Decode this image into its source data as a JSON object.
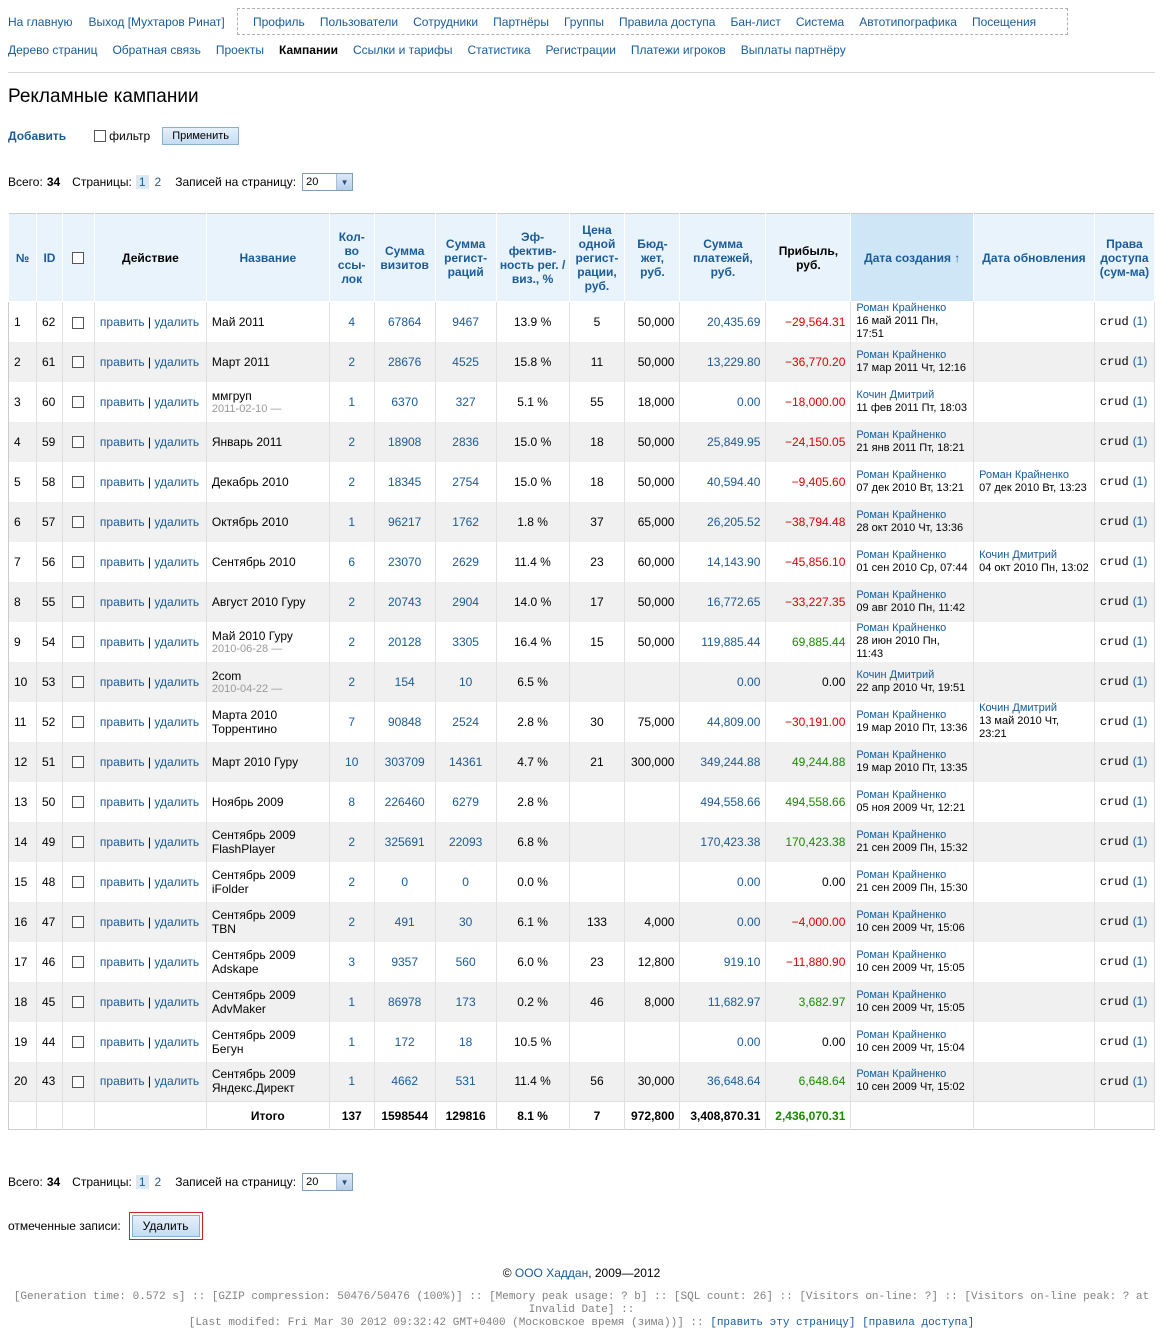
{
  "nav_top": {
    "left": [
      "На главную",
      "Выход [Мухтаров Ринат]"
    ],
    "box": [
      "Профиль",
      "Пользователи",
      "Сотрудники",
      "Партнёры",
      "Группы",
      "Правила доступа",
      "Бан-лист",
      "Система",
      "Автотипографика",
      "Посещения"
    ]
  },
  "nav_sub": {
    "items": [
      "Дерево страниц",
      "Обратная связь",
      "Проекты",
      "Кампании",
      "Ссылки и тарифы",
      "Статистика",
      "Регистрации",
      "Платежи игроков",
      "Выплаты партнёру"
    ],
    "active": "Кампании"
  },
  "page_title": "Рекламные кампании",
  "toolbar": {
    "add": "Добавить",
    "filter": "фильтр",
    "apply": "Применить"
  },
  "pager": {
    "total_label": "Всего:",
    "total": "34",
    "pages_label": "Страницы:",
    "page1": "1",
    "page2": "2",
    "per_page_label": "Записей на страницу:",
    "per_page": "20"
  },
  "table": {
    "headers": {
      "num": "№",
      "id": "ID",
      "action": "Действие",
      "name": "Название",
      "links": "Кол-во ссы-лок",
      "visits": "Сумма визитов",
      "regs": "Сумма регист-раций",
      "eff": "Эф-фектив-ность рег. / виз., %",
      "price": "Цена одной регист-рации, руб.",
      "budget": "Бюд-жет, руб.",
      "payments": "Сумма платежей, руб.",
      "profit": "Прибыль, руб.",
      "created": "Дата создания ↑",
      "updated": "Дата обновления",
      "rights": "Права доступа (сум-ма)"
    },
    "edit": "править",
    "delete": "удалить",
    "rows": [
      {
        "n": "1",
        "id": "62",
        "name": "Май 2011",
        "sub": "",
        "links": "4",
        "visits": "67864",
        "regs": "9467",
        "eff": "13.9 %",
        "price": "5",
        "budget": "50,000",
        "pay": "20,435.69",
        "profit": "−29,564.31",
        "ps": "neg",
        "cw": "Роман Крайненко",
        "cd": "16 май 2011 Пн, 17:51",
        "uw": "",
        "ud": "",
        "rights": "crud",
        "rc": "(1)"
      },
      {
        "n": "2",
        "id": "61",
        "name": "Март 2011",
        "sub": "",
        "links": "2",
        "visits": "28676",
        "regs": "4525",
        "eff": "15.8 %",
        "price": "11",
        "budget": "50,000",
        "pay": "13,229.80",
        "profit": "−36,770.20",
        "ps": "neg",
        "cw": "Роман Крайненко",
        "cd": "17 мар 2011 Чт, 12:16",
        "uw": "",
        "ud": "",
        "rights": "crud",
        "rc": "(1)"
      },
      {
        "n": "3",
        "id": "60",
        "name": "ммгруп",
        "sub": "2011-02-10 —",
        "links": "1",
        "visits": "6370",
        "regs": "327",
        "eff": "5.1 %",
        "price": "55",
        "budget": "18,000",
        "pay": "0.00",
        "profit": "−18,000.00",
        "ps": "neg",
        "cw": "Кочин Дмитрий",
        "cd": "11 фев 2011 Пт, 18:03",
        "uw": "",
        "ud": "",
        "rights": "crud",
        "rc": "(1)"
      },
      {
        "n": "4",
        "id": "59",
        "name": "Январь 2011",
        "sub": "",
        "links": "2",
        "visits": "18908",
        "regs": "2836",
        "eff": "15.0 %",
        "price": "18",
        "budget": "50,000",
        "pay": "25,849.95",
        "profit": "−24,150.05",
        "ps": "neg",
        "cw": "Роман Крайненко",
        "cd": "21 янв 2011 Пт, 18:21",
        "uw": "",
        "ud": "",
        "rights": "crud",
        "rc": "(1)"
      },
      {
        "n": "5",
        "id": "58",
        "name": "Декабрь 2010",
        "sub": "",
        "links": "2",
        "visits": "18345",
        "regs": "2754",
        "eff": "15.0 %",
        "price": "18",
        "budget": "50,000",
        "pay": "40,594.40",
        "profit": "−9,405.60",
        "ps": "neg",
        "cw": "Роман Крайненко",
        "cd": "07 дек 2010 Вт, 13:21",
        "uw": "Роман Крайненко",
        "ud": "07 дек 2010 Вт, 13:23",
        "rights": "crud",
        "rc": "(1)"
      },
      {
        "n": "6",
        "id": "57",
        "name": "Октябрь 2010",
        "sub": "",
        "links": "1",
        "visits": "96217",
        "regs": "1762",
        "eff": "1.8 %",
        "price": "37",
        "budget": "65,000",
        "pay": "26,205.52",
        "profit": "−38,794.48",
        "ps": "neg",
        "cw": "Роман Крайненко",
        "cd": "28 окт 2010 Чт, 13:36",
        "uw": "",
        "ud": "",
        "rights": "crud",
        "rc": "(1)"
      },
      {
        "n": "7",
        "id": "56",
        "name": "Сентябрь 2010",
        "sub": "",
        "links": "6",
        "visits": "23070",
        "regs": "2629",
        "eff": "11.4 %",
        "price": "23",
        "budget": "60,000",
        "pay": "14,143.90",
        "profit": "−45,856.10",
        "ps": "neg",
        "cw": "Роман Крайненко",
        "cd": "01 сен 2010 Ср, 07:44",
        "uw": "Кочин Дмитрий",
        "ud": "04 окт 2010 Пн, 13:02",
        "rights": "crud",
        "rc": "(1)"
      },
      {
        "n": "8",
        "id": "55",
        "name": "Август 2010 Гуру",
        "sub": "",
        "links": "2",
        "visits": "20743",
        "regs": "2904",
        "eff": "14.0 %",
        "price": "17",
        "budget": "50,000",
        "pay": "16,772.65",
        "profit": "−33,227.35",
        "ps": "neg",
        "cw": "Роман Крайненко",
        "cd": "09 авг 2010 Пн, 11:42",
        "uw": "",
        "ud": "",
        "rights": "crud",
        "rc": "(1)"
      },
      {
        "n": "9",
        "id": "54",
        "name": "Май 2010 Гуру",
        "sub": "2010-06-28 —",
        "links": "2",
        "visits": "20128",
        "regs": "3305",
        "eff": "16.4 %",
        "price": "15",
        "budget": "50,000",
        "pay": "119,885.44",
        "profit": "69,885.44",
        "ps": "pos",
        "cw": "Роман Крайненко",
        "cd": "28 июн 2010 Пн, 11:43",
        "uw": "",
        "ud": "",
        "rights": "crud",
        "rc": "(1)"
      },
      {
        "n": "10",
        "id": "53",
        "name": "2com",
        "sub": "2010-04-22 —",
        "links": "2",
        "visits": "154",
        "regs": "10",
        "eff": "6.5 %",
        "price": "",
        "budget": "",
        "pay": "0.00",
        "profit": "0.00",
        "ps": "zero",
        "cw": "Кочин Дмитрий",
        "cd": "22 апр 2010 Чт, 19:51",
        "uw": "",
        "ud": "",
        "rights": "crud",
        "rc": "(1)"
      },
      {
        "n": "11",
        "id": "52",
        "name": "Марта 2010\nТоррентино",
        "sub": "",
        "links": "7",
        "visits": "90848",
        "regs": "2524",
        "eff": "2.8 %",
        "price": "30",
        "budget": "75,000",
        "pay": "44,809.00",
        "profit": "−30,191.00",
        "ps": "neg",
        "cw": "Роман Крайненко",
        "cd": "19 мар 2010 Пт, 13:36",
        "uw": "Кочин Дмитрий",
        "ud": "13 май 2010 Чт, 23:21",
        "rights": "crud",
        "rc": "(1)"
      },
      {
        "n": "12",
        "id": "51",
        "name": "Март 2010 Гуру",
        "sub": "",
        "links": "10",
        "visits": "303709",
        "regs": "14361",
        "eff": "4.7 %",
        "price": "21",
        "budget": "300,000",
        "pay": "349,244.88",
        "profit": "49,244.88",
        "ps": "pos",
        "cw": "Роман Крайненко",
        "cd": "19 мар 2010 Пт, 13:35",
        "uw": "",
        "ud": "",
        "rights": "crud",
        "rc": "(1)"
      },
      {
        "n": "13",
        "id": "50",
        "name": "Ноябрь 2009",
        "sub": "",
        "links": "8",
        "visits": "226460",
        "regs": "6279",
        "eff": "2.8 %",
        "price": "",
        "budget": "",
        "pay": "494,558.66",
        "profit": "494,558.66",
        "ps": "pos",
        "cw": "Роман Крайненко",
        "cd": "05 ноя 2009 Чт, 12:21",
        "uw": "",
        "ud": "",
        "rights": "crud",
        "rc": "(1)"
      },
      {
        "n": "14",
        "id": "49",
        "name": "Сентябрь 2009\nFlashPlayer",
        "sub": "",
        "links": "2",
        "visits": "325691",
        "regs": "22093",
        "eff": "6.8 %",
        "price": "",
        "budget": "",
        "pay": "170,423.38",
        "profit": "170,423.38",
        "ps": "pos",
        "cw": "Роман Крайненко",
        "cd": "21 сен 2009 Пн, 15:32",
        "uw": "",
        "ud": "",
        "rights": "crud",
        "rc": "(1)"
      },
      {
        "n": "15",
        "id": "48",
        "name": "Сентябрь 2009\niFolder",
        "sub": "",
        "links": "2",
        "visits": "0",
        "regs": "0",
        "eff": "0.0 %",
        "price": "",
        "budget": "",
        "pay": "0.00",
        "profit": "0.00",
        "ps": "zero",
        "cw": "Роман Крайненко",
        "cd": "21 сен 2009 Пн, 15:30",
        "uw": "",
        "ud": "",
        "rights": "crud",
        "rc": "(1)"
      },
      {
        "n": "16",
        "id": "47",
        "name": "Сентябрь 2009\nTBN",
        "sub": "",
        "links": "2",
        "visits": "491",
        "regs": "30",
        "eff": "6.1 %",
        "price": "133",
        "budget": "4,000",
        "pay": "0.00",
        "profit": "−4,000.00",
        "ps": "neg",
        "cw": "Роман Крайненко",
        "cd": "10 сен 2009 Чт, 15:06",
        "uw": "",
        "ud": "",
        "rights": "crud",
        "rc": "(1)"
      },
      {
        "n": "17",
        "id": "46",
        "name": "Сентябрь 2009\nAdskape",
        "sub": "",
        "links": "3",
        "visits": "9357",
        "regs": "560",
        "eff": "6.0 %",
        "price": "23",
        "budget": "12,800",
        "pay": "919.10",
        "profit": "−11,880.90",
        "ps": "neg",
        "cw": "Роман Крайненко",
        "cd": "10 сен 2009 Чт, 15:05",
        "uw": "",
        "ud": "",
        "rights": "crud",
        "rc": "(1)"
      },
      {
        "n": "18",
        "id": "45",
        "name": "Сентябрь 2009\nAdvMaker",
        "sub": "",
        "links": "1",
        "visits": "86978",
        "regs": "173",
        "eff": "0.2 %",
        "price": "46",
        "budget": "8,000",
        "pay": "11,682.97",
        "profit": "3,682.97",
        "ps": "pos",
        "cw": "Роман Крайненко",
        "cd": "10 сен 2009 Чт, 15:05",
        "uw": "",
        "ud": "",
        "rights": "crud",
        "rc": "(1)"
      },
      {
        "n": "19",
        "id": "44",
        "name": "Сентябрь 2009\nБегун",
        "sub": "",
        "links": "1",
        "visits": "172",
        "regs": "18",
        "eff": "10.5 %",
        "price": "",
        "budget": "",
        "pay": "0.00",
        "profit": "0.00",
        "ps": "zero",
        "cw": "Роман Крайненко",
        "cd": "10 сен 2009 Чт, 15:04",
        "uw": "",
        "ud": "",
        "rights": "crud",
        "rc": "(1)"
      },
      {
        "n": "20",
        "id": "43",
        "name": "Сентябрь 2009\nЯндекс.Директ",
        "sub": "",
        "links": "1",
        "visits": "4662",
        "regs": "531",
        "eff": "11.4 %",
        "price": "56",
        "budget": "30,000",
        "pay": "36,648.64",
        "profit": "6,648.64",
        "ps": "pos",
        "cw": "Роман Крайненко",
        "cd": "10 сен 2009 Чт, 15:02",
        "uw": "",
        "ud": "",
        "rights": "crud",
        "rc": "(1)"
      }
    ],
    "totals": {
      "label": "Итого",
      "links": "137",
      "visits": "1598544",
      "regs": "129816",
      "eff": "8.1 %",
      "price": "7",
      "budget": "972,800",
      "pay": "3,408,870.31",
      "profit": "2,436,070.31"
    }
  },
  "bulk": {
    "label": "отмеченные записи:",
    "delete": "Удалить"
  },
  "footer": {
    "copy": "©",
    "company": "ООО Хаддан",
    "years": ", 2009—2012",
    "debug1": "[Generation time: 0.572 s] :: [GZIP compression: 50476/50476 (100%)] :: [Memory peak usage: ? b] :: [SQL count: 26] :: [Visitors on-line: ?] :: [Visitors on-line peak: ? at Invalid Date] ::",
    "debug2_pre": "[Last modifed: Fri Mar 30 2012 09:32:42 GMT+0400 (Московское время (зима))] ::",
    "edit_page": "[править эту страницу]",
    "access_rules": "[правила доступа]"
  }
}
